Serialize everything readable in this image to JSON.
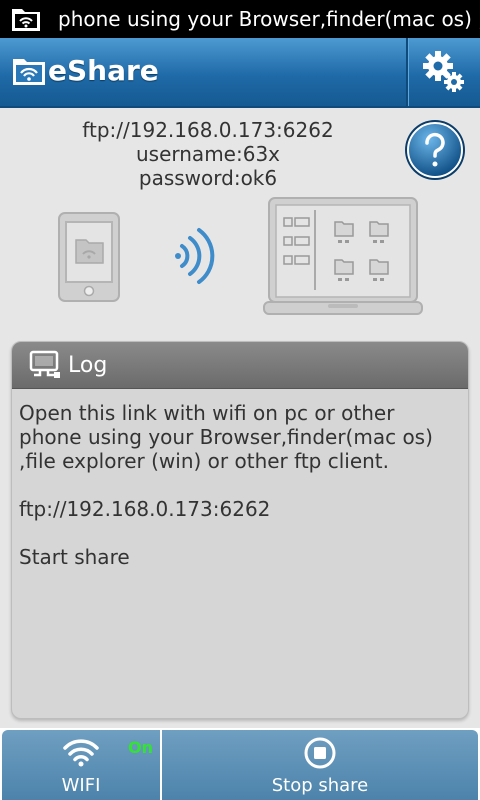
{
  "status_bar": {
    "notification_text": "phone using your Browser,finder(mac os) ,",
    "icon": "folder-wifi-icon"
  },
  "header": {
    "title": "eShare",
    "logo_icon": "folder-wifi-icon",
    "settings_icon": "gear-icon"
  },
  "info": {
    "ftp_url": "ftp://192.168.0.173:6262",
    "username": "username:63x",
    "password": "password:ok6",
    "help_icon": "help-icon"
  },
  "log": {
    "title": "Log",
    "icon": "computer-icon",
    "lines": [
      "Open this link with wifi on pc or other phone using your Browser,finder(mac os) ,file explorer (win) or other ftp client.",
      "ftp://192.168.0.173:6262",
      "Start share"
    ]
  },
  "bottom_bar": {
    "wifi_label": "WIFI",
    "wifi_status": "On",
    "stop_label": "Stop share"
  },
  "colors": {
    "header_blue": "#1f6aa8",
    "tab_blue": "#5b8fb5",
    "on_green": "#34e234"
  }
}
